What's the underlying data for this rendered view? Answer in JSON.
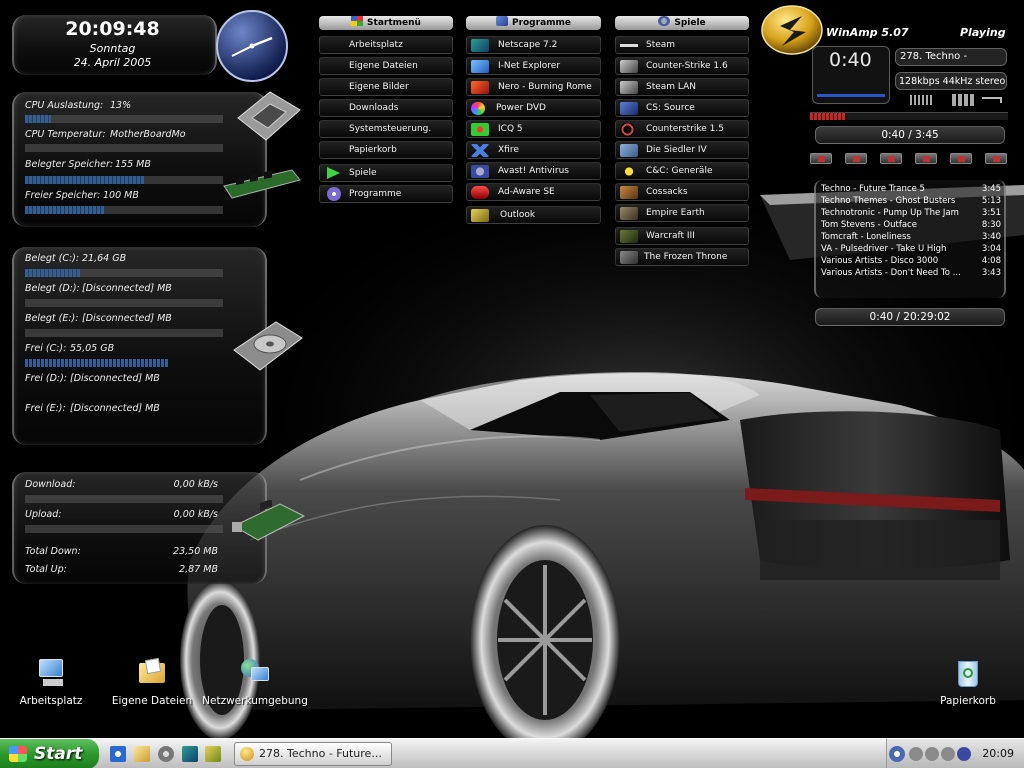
{
  "clock": {
    "time": "20:09:48",
    "day": "Sonntag",
    "date": "24. April 2005"
  },
  "system": {
    "cpu_label": "CPU Auslastung:",
    "cpu_value": "13%",
    "cpu_load": 0.13,
    "temp_label": "CPU Temperatur:",
    "temp_value": "MotherBoardMon",
    "used_mem_label": "Belegter Speicher:",
    "used_mem_value": "155 MB",
    "used_mem_fraction": 0.6,
    "free_mem_label": "Freier Speicher:",
    "free_mem_value": "100 MB",
    "free_mem_fraction": 0.4
  },
  "drives": {
    "used_c_label": "Belegt (C:):",
    "used_c_value": "21,64 GB",
    "used_c_fraction": 0.28,
    "used_d_label": "Belegt (D:):",
    "used_d_value": "[Disconnected] MB",
    "used_e_label": "Belegt (E:):",
    "used_e_value": "[Disconnected] MB",
    "free_c_label": "Frei (C:):",
    "free_c_value": "55,05 GB",
    "free_c_fraction": 0.72,
    "free_d_label": "Frei (D:):",
    "free_d_value": "[Disconnected] MB",
    "free_e_label": "Frei (E:):",
    "free_e_value": "[Disconnected] MB"
  },
  "network": {
    "download_label": "Download:",
    "download_value": "0,00 kB/s",
    "upload_label": "Upload:",
    "upload_value": "0,00 kB/s",
    "total_down_label": "Total Down:",
    "total_down_value": "23,50 MB",
    "total_up_label": "Total Up:",
    "total_up_value": "2,87 MB"
  },
  "menus": {
    "start_title": "Startmenü",
    "start_items": [
      "Arbeitsplatz",
      "Eigene Dateien",
      "Eigene Bilder",
      "Downloads",
      "Systemsteuerung.",
      "Papierkorb",
      "Spiele",
      "Programme"
    ],
    "programs_title": "Programme",
    "programs_items": [
      "Netscape 7.2",
      "I-Net Explorer",
      "Nero - Burning Rome",
      "Power DVD",
      "ICQ 5",
      "Xfire",
      "Avast! Antivirus",
      "Ad-Aware SE",
      "Outlook"
    ],
    "games_title": "Spiele",
    "games_items": [
      "Steam",
      "Counter-Strike 1.6",
      "Steam LAN",
      "CS: Source",
      "Counterstrike 1.5",
      "Die Siedler IV",
      "C&C: Generäle",
      "Cossacks",
      "Empire Earth",
      "Warcraft III",
      "The Frozen Throne"
    ]
  },
  "winamp": {
    "title": "WinAmp 5.07",
    "status": "Playing",
    "elapsed": "0:40",
    "track": "278. Techno -",
    "bitrate": "128kbps 44kHz stereo",
    "position": "0:40 / 3:45",
    "position_fraction": 0.18,
    "total": "0:40 / 20:29:02",
    "playlist": [
      {
        "title": "Techno - Future Trance 5",
        "duration": "3:45"
      },
      {
        "title": "Techno Themes - Ghost Busters",
        "duration": "5:13"
      },
      {
        "title": "Technotronic - Pump Up The Jam",
        "duration": "3:51"
      },
      {
        "title": "Tom Stevens - Outface",
        "duration": "8:30"
      },
      {
        "title": "Tomcraft - Loneliness",
        "duration": "3:40"
      },
      {
        "title": "VA - Pulsedriver - Take U High",
        "duration": "3:04"
      },
      {
        "title": "Various Artists - Disco 3000",
        "duration": "4:08"
      },
      {
        "title": "Various Artists - Don't Need To ...",
        "duration": "3:43"
      }
    ]
  },
  "desktop_icons": [
    "Arbeitsplatz",
    "Eigene Dateien",
    "Netzwerkumgebung",
    "Papierkorb"
  ],
  "taskbar": {
    "start": "Start",
    "task": "278. Techno - Future...",
    "clock": "20:09"
  },
  "icons": {
    "clock": "analog-clock-icon",
    "cpu": "cpu-chip-icon",
    "ram": "ram-module-icon",
    "hdd": "hard-disk-icon",
    "network": "network-card-icon",
    "winamp": "winamp-logo-icon"
  },
  "colors": {
    "bar_fill": "#2f5f9a",
    "start_green": "#2d9a2d",
    "winamp_red": "#cc2222"
  }
}
